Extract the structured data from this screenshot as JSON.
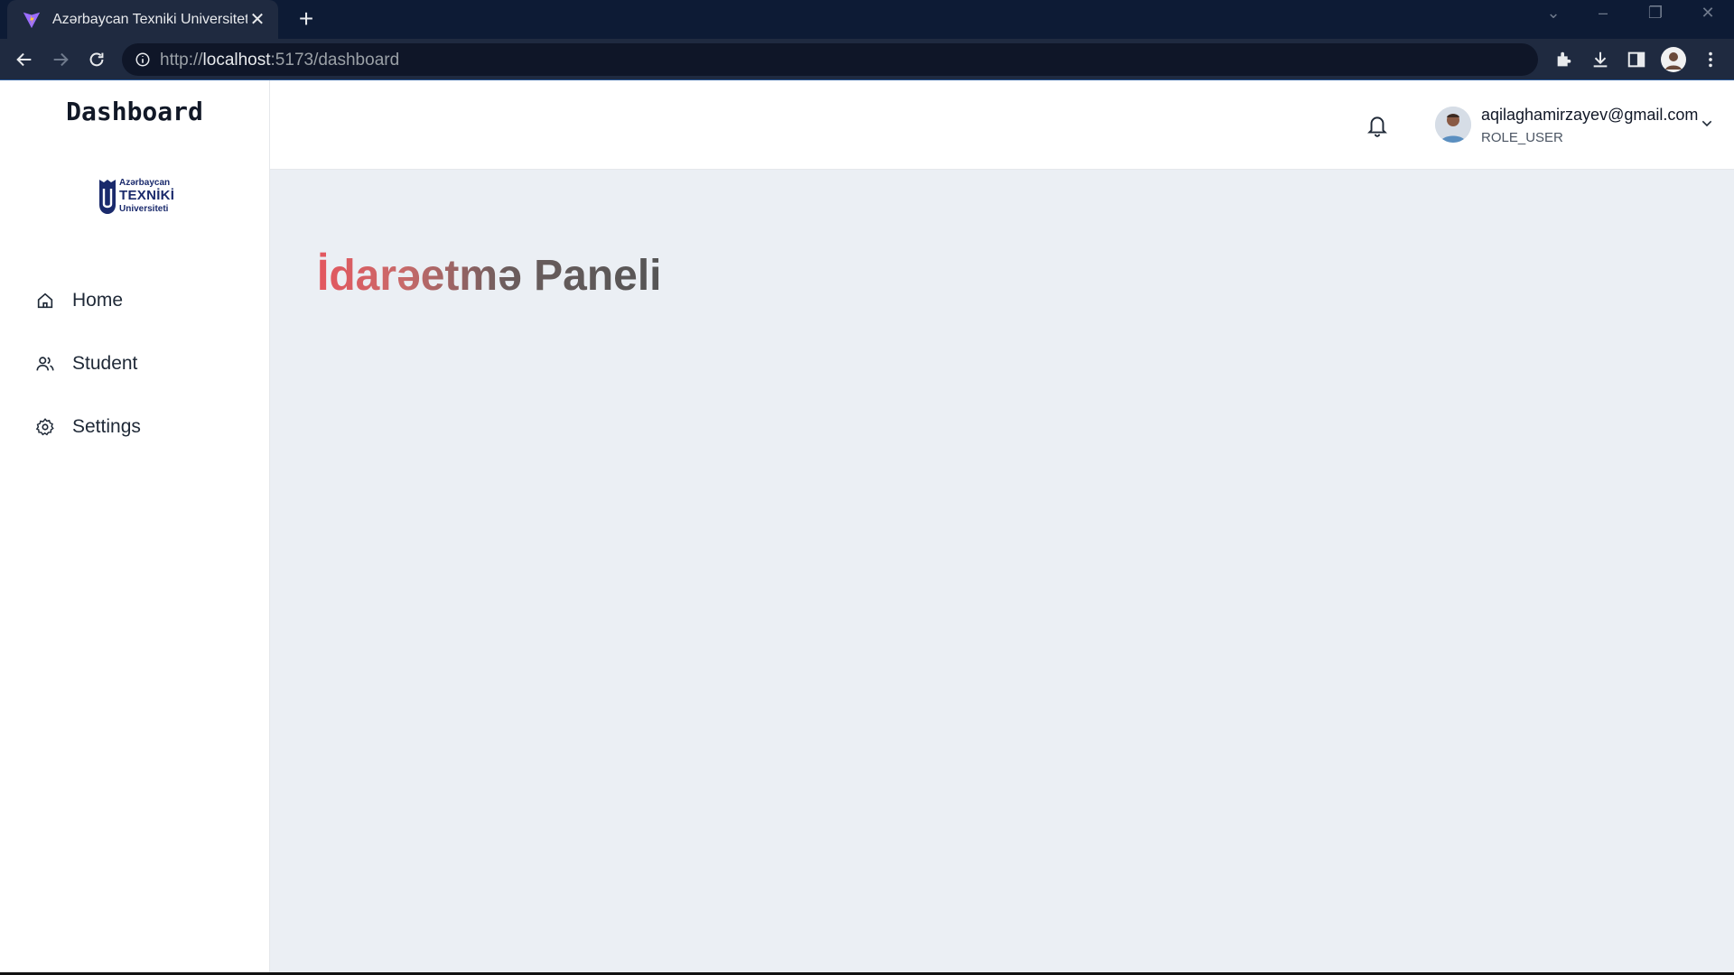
{
  "browser": {
    "tab_title": "Azərbaycan Texniki Universiteti",
    "url_scheme": "http://",
    "url_host": "localhost",
    "url_rest": ":5173/dashboard"
  },
  "sidebar": {
    "brand": "Dashboard",
    "logo": {
      "line1": "Azərbaycan",
      "line2": "TEXNİKİ",
      "line3": "Universiteti"
    },
    "items": [
      {
        "label": "Home",
        "icon": "home-icon"
      },
      {
        "label": "Student",
        "icon": "users-icon"
      },
      {
        "label": "Settings",
        "icon": "gear-icon"
      }
    ]
  },
  "header": {
    "user_email": "aqilaghamirzayev@gmail.com",
    "user_role": "ROLE_USER"
  },
  "main": {
    "title": "İdarəetmə Paneli"
  },
  "colors": {
    "chrome_dark": "#0d1b35",
    "chrome_toolbar": "#1f2a40",
    "main_bg": "#ebeff4",
    "title_start": "#e4565e",
    "title_end": "#555555",
    "logo_blue": "#1a2a6c"
  }
}
